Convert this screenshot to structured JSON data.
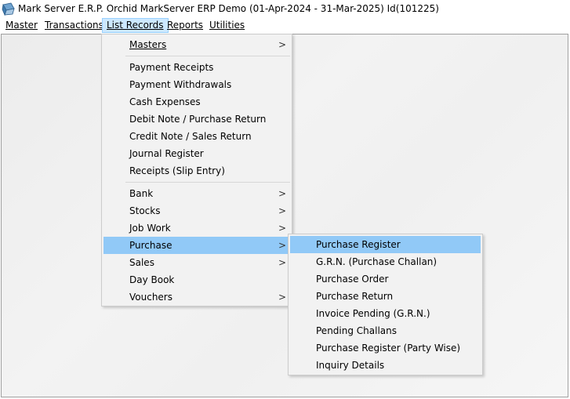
{
  "window": {
    "title": "Mark Server E.R.P. Orchid MarkServer ERP Demo (01-Apr-2024 - 31-Mar-2025) Id(101225)",
    "icon": "app-logo-icon"
  },
  "menubar": {
    "items": [
      {
        "label": "Master"
      },
      {
        "label": "Transactions"
      },
      {
        "label": "List Records"
      },
      {
        "label": "Reports"
      },
      {
        "label": "Utilities"
      }
    ]
  },
  "list_records_menu": {
    "group1": [
      {
        "label": "Masters",
        "has_submenu": true
      }
    ],
    "group2": [
      {
        "label": "Payment Receipts"
      },
      {
        "label": "Payment Withdrawals"
      },
      {
        "label": "Cash Expenses"
      },
      {
        "label": "Debit Note / Purchase Return"
      },
      {
        "label": "Credit Note / Sales Return"
      },
      {
        "label": "Journal Register"
      },
      {
        "label": "Receipts (Slip Entry)"
      }
    ],
    "group3": [
      {
        "label": "Bank",
        "has_submenu": true
      },
      {
        "label": "Stocks",
        "has_submenu": true
      },
      {
        "label": "Job Work",
        "has_submenu": true
      },
      {
        "label": "Purchase",
        "has_submenu": true,
        "highlighted": true
      },
      {
        "label": "Sales",
        "has_submenu": true
      },
      {
        "label": "Day Book"
      },
      {
        "label": "Vouchers",
        "has_submenu": true
      }
    ],
    "submenu_arrow": ">"
  },
  "purchase_submenu": {
    "items": [
      {
        "label": "Purchase Register",
        "highlighted": true
      },
      {
        "label": "G.R.N. (Purchase Challan)"
      },
      {
        "label": "Purchase Order"
      },
      {
        "label": "Purchase Return"
      },
      {
        "label": "Invoice Pending (G.R.N.)"
      },
      {
        "label": "Pending Challans"
      },
      {
        "label": "Purchase Register (Party Wise)"
      },
      {
        "label": "Inquiry Details"
      }
    ]
  },
  "colors": {
    "highlight": "#91c9f7",
    "active_menu_bg": "#cce8ff",
    "menu_bg": "#f2f2f2"
  }
}
